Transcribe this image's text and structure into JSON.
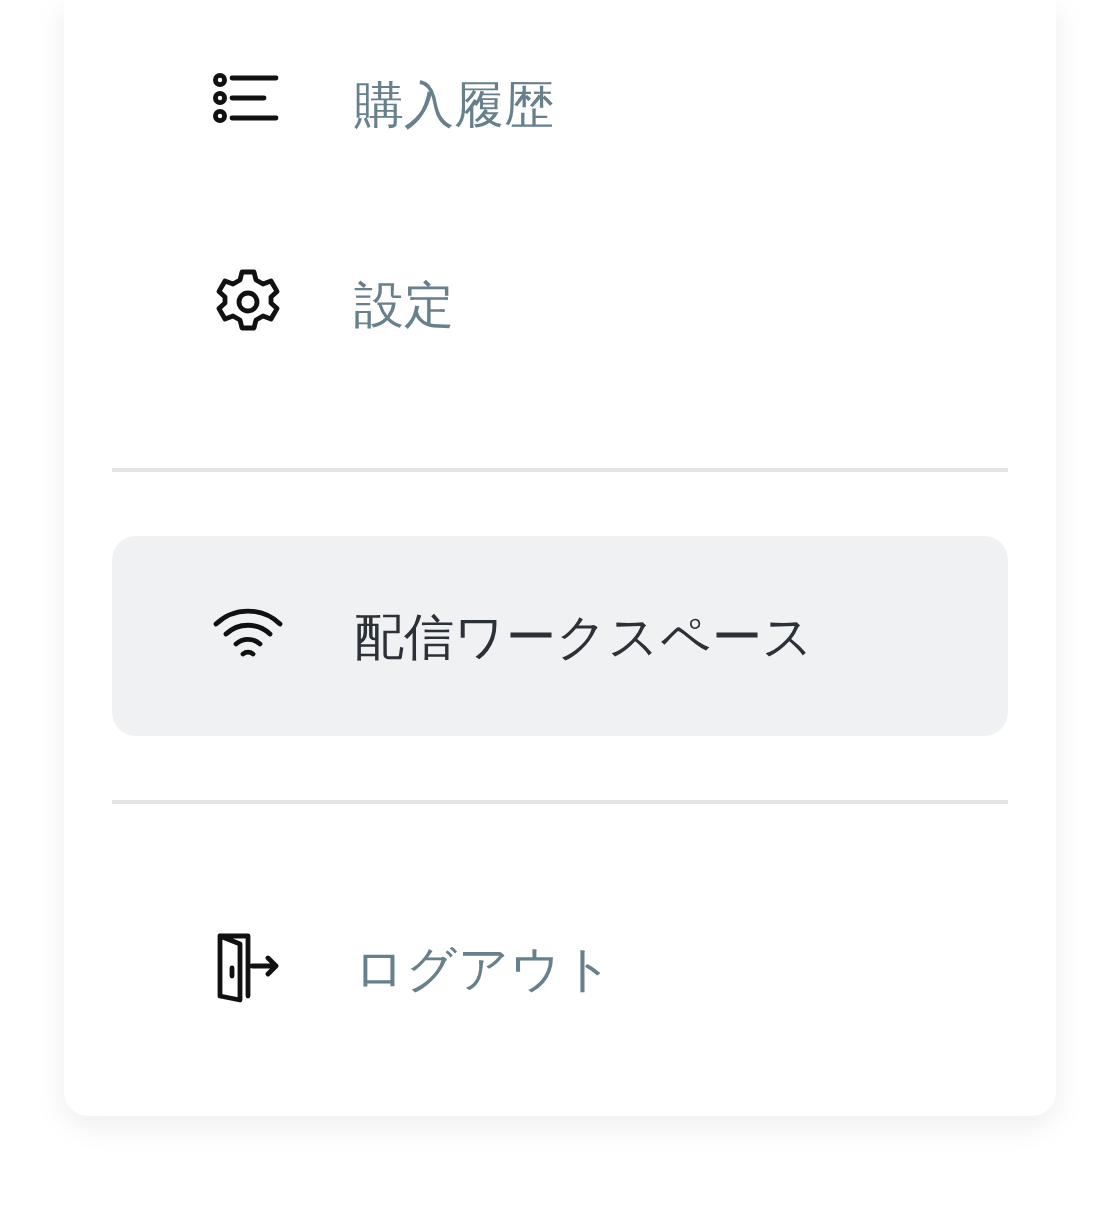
{
  "menu": {
    "groups": [
      {
        "items": [
          {
            "label": "購入履歴",
            "selected": false
          },
          {
            "label": "設定",
            "selected": false
          }
        ]
      },
      {
        "items": [
          {
            "label": "配信ワークスペース",
            "selected": true
          }
        ]
      },
      {
        "items": [
          {
            "label": "ログアウト",
            "selected": false
          }
        ]
      }
    ]
  }
}
